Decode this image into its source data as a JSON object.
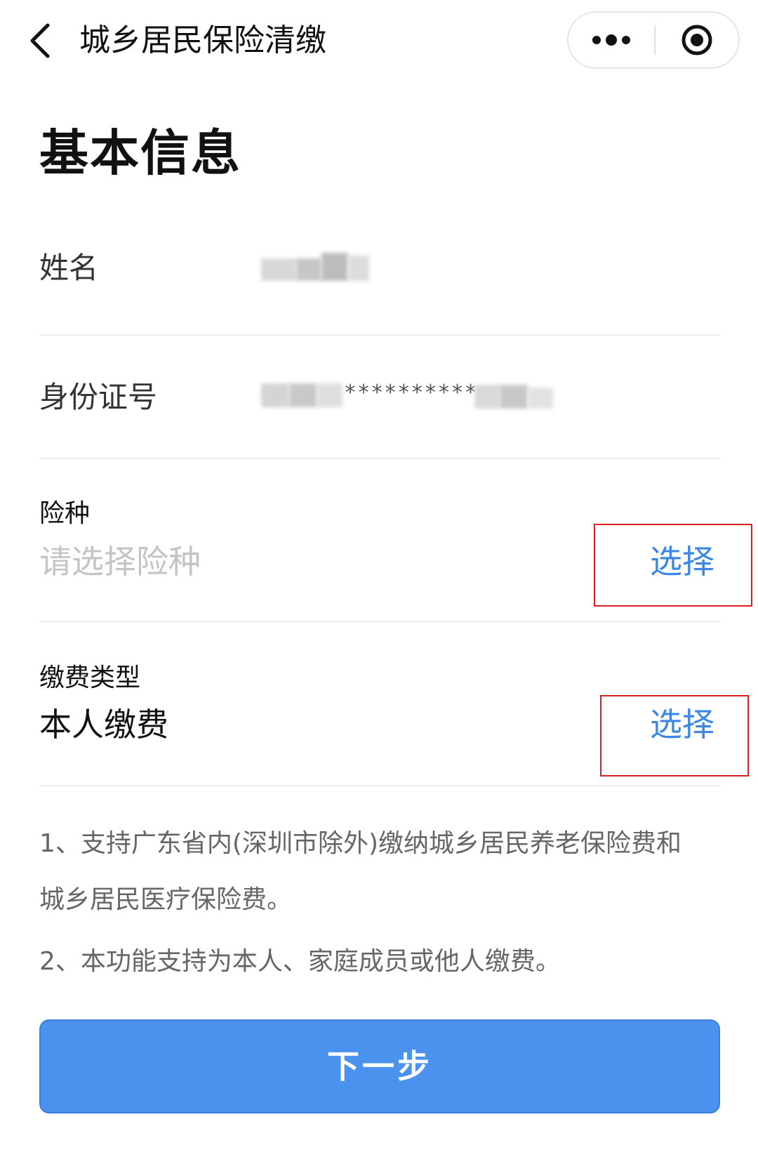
{
  "navbar": {
    "back_icon": "chevron-left-icon",
    "title": "城乡居民保险清缴",
    "more_icon": "more-dots-icon",
    "close_icon": "record-circle-icon"
  },
  "page": {
    "title": "基本信息"
  },
  "form": {
    "name": {
      "label": "姓名",
      "value_masked": true
    },
    "id_number": {
      "label": "身份证号",
      "masked_middle": "**********",
      "value_masked": true
    },
    "insurance_type": {
      "label": "险种",
      "placeholder": "请选择险种",
      "select_label": "选择"
    },
    "payment_type": {
      "label": "缴费类型",
      "value": "本人缴费",
      "select_label": "选择"
    }
  },
  "notes": [
    "1、支持广东省内(深圳市除外)缴纳城乡居民养老保险费和城乡居民医疗保险费。",
    "2、本功能支持为本人、家庭成员或他人缴费。"
  ],
  "actions": {
    "next_label": "下一步"
  },
  "colors": {
    "accent_link": "#3c86e6",
    "primary_button": "#4a92ee",
    "annotation_box": "#e02020",
    "placeholder": "#c4c4c4"
  }
}
